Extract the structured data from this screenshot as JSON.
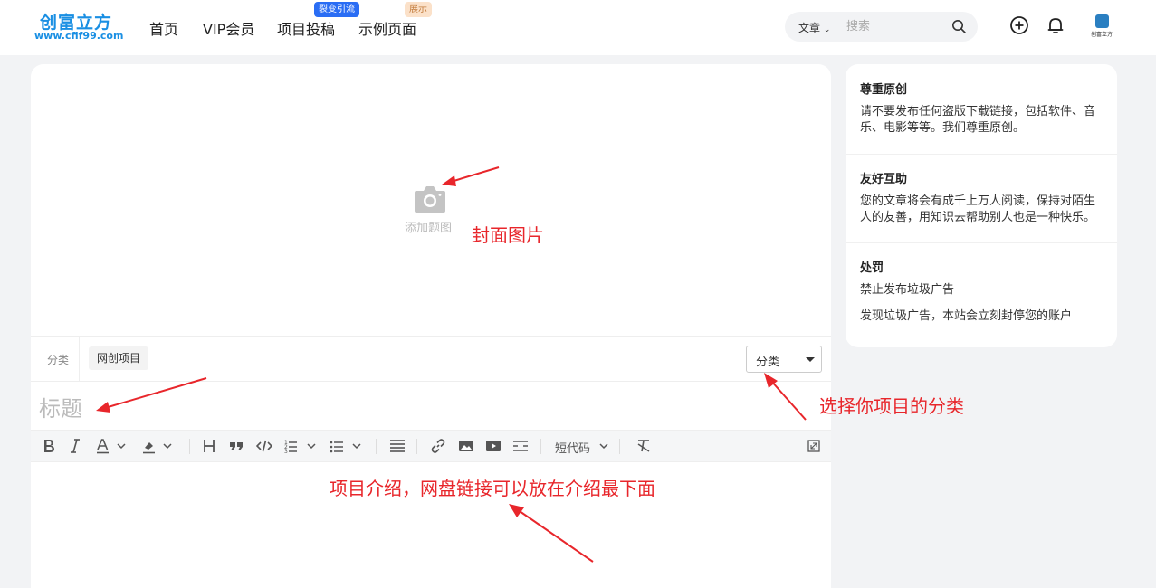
{
  "header": {
    "logo_main": "创富立方",
    "logo_sub": "www.cfif99.com",
    "nav": [
      {
        "label": "首页"
      },
      {
        "label": "VIP会员"
      },
      {
        "label": "项目投稿",
        "badge": "裂变引流"
      },
      {
        "label": "示例页面",
        "badge": "展示"
      }
    ],
    "search_type": "文章",
    "search_placeholder": "搜索",
    "avatar_text": "创富立方",
    "icons": [
      "plus-circle-icon",
      "bell-icon",
      "search-icon"
    ]
  },
  "editor": {
    "cover_label": "添加题图",
    "category_label": "分类",
    "category_tag": "网创项目",
    "category_select": "分类",
    "title_placeholder": "标题",
    "toolbar_shortcode": "短代码"
  },
  "sidebar": {
    "sections": [
      {
        "title": "尊重原创",
        "lines": [
          "请不要发布任何盗版下载链接，包括软件、音乐、电影等等。我们尊重原创。"
        ]
      },
      {
        "title": "友好互助",
        "lines": [
          "您的文章将会有成千上万人阅读，保持对陌生人的友善，用知识去帮助别人也是一种快乐。"
        ]
      },
      {
        "title": "处罚",
        "lines": [
          "禁止发布垃圾广告",
          "发现垃圾广告，本站会立刻封停您的账户"
        ]
      }
    ]
  },
  "annotations": {
    "cover": "封面图片",
    "category": "选择你项目的分类",
    "intro": "项目介绍，网盘链接可以放在介绍最下面"
  },
  "colors": {
    "brand_blue": "#1a8fe3",
    "annotation_red": "#e8262b",
    "badge_blue": "#2a6df4",
    "badge_orange": "#fbe1c9"
  }
}
